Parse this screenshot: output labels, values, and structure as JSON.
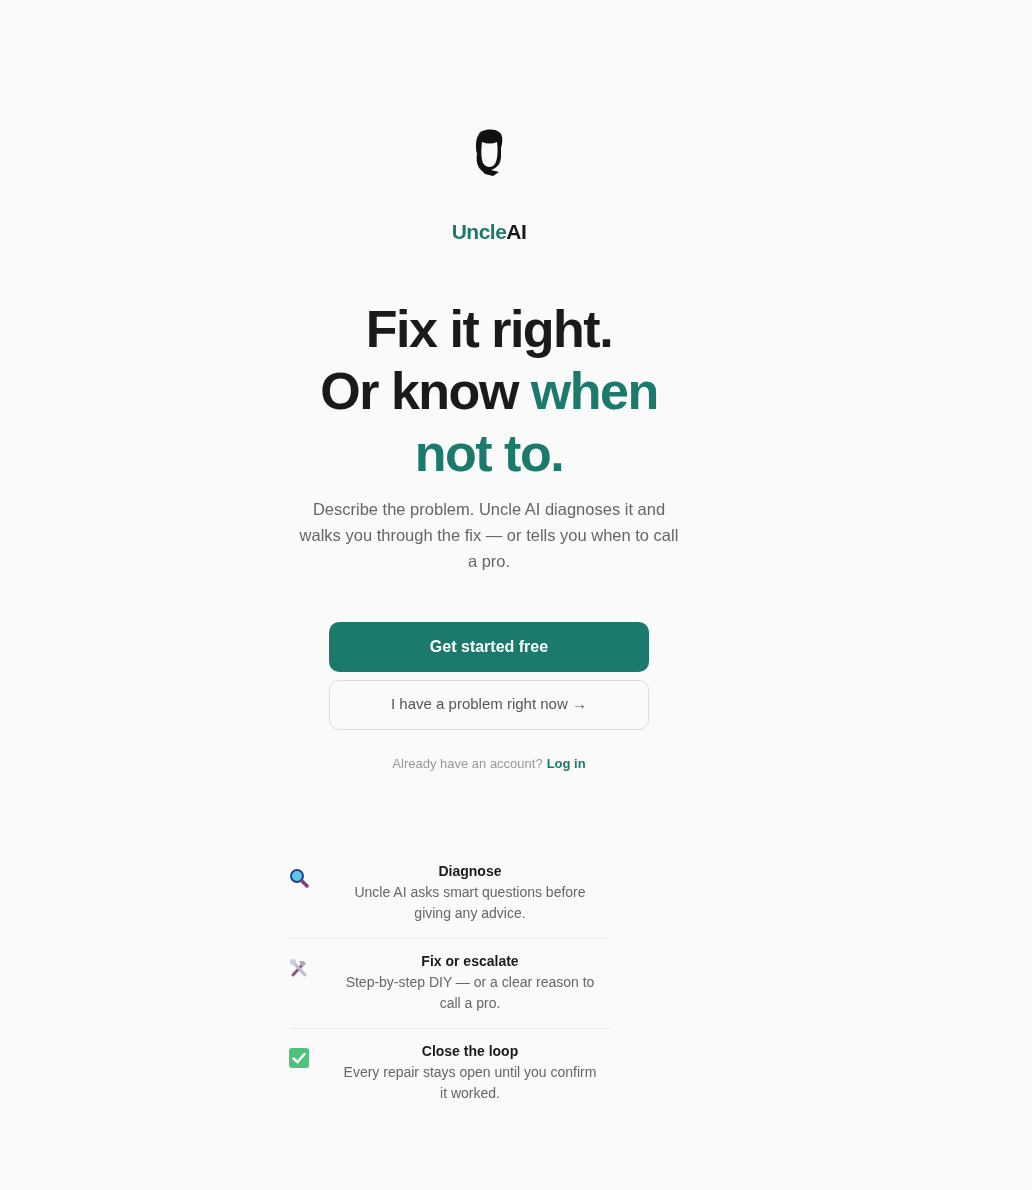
{
  "brand": [
    {
      "text": "Uncle",
      "accent": true
    },
    {
      "text": "AI",
      "accent": false
    }
  ],
  "headline": [
    [
      {
        "text": "Fix it right.",
        "accent": false
      }
    ],
    [
      {
        "text": "Or know ",
        "accent": false
      },
      {
        "text": "when not to.",
        "accent": true
      }
    ]
  ],
  "subtitle": "Describe the problem. Uncle AI diagnoses it and walks you through the fix — or tells you when to call a pro.",
  "primary_button": "Get started free",
  "secondary_button": "I have a problem right now →",
  "login": {
    "prompt": "Already have an account?",
    "link": "Log in"
  },
  "features": [
    {
      "kind": "magnifier",
      "title": "Diagnose",
      "text": "Uncle AI asks smart questions before giving any advice."
    },
    {
      "kind": "tools",
      "title": "Fix or escalate",
      "text": "Step-by-step DIY — or a clear reason to call a pro."
    },
    {
      "kind": "check",
      "title": "Close the loop",
      "text": "Every repair stays open until you confirm it worked."
    }
  ]
}
